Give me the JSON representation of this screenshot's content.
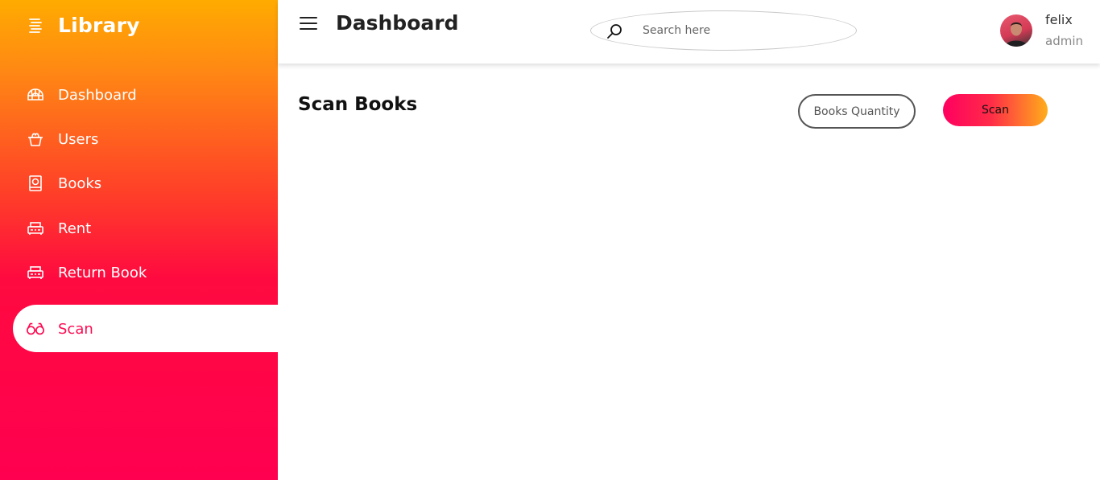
{
  "brand": {
    "title": "Library",
    "icon": "library-icon"
  },
  "sidebar": {
    "items": [
      {
        "label": "Dashboard",
        "icon": "igloo-icon",
        "active": false
      },
      {
        "label": "Users",
        "icon": "users-icon",
        "active": false
      },
      {
        "label": "Books",
        "icon": "book-icon",
        "active": false
      },
      {
        "label": "Rent",
        "icon": "rent-icon",
        "active": false
      },
      {
        "label": "Return Book",
        "icon": "return-icon",
        "active": false
      },
      {
        "label": "Scan",
        "icon": "binoculars-icon",
        "active": true
      }
    ]
  },
  "topbar": {
    "title": "Dashboard",
    "search": {
      "placeholder": "Search here",
      "value": ""
    },
    "user": {
      "name": "felix",
      "role": "admin"
    }
  },
  "main": {
    "title": "Scan Books",
    "quantity_button": "Books Quantity",
    "scan_button": "Scan"
  },
  "colors": {
    "sidebar_top": "#ffab00",
    "sidebar_bottom": "#ff0050",
    "accent": "#ff0a50"
  }
}
